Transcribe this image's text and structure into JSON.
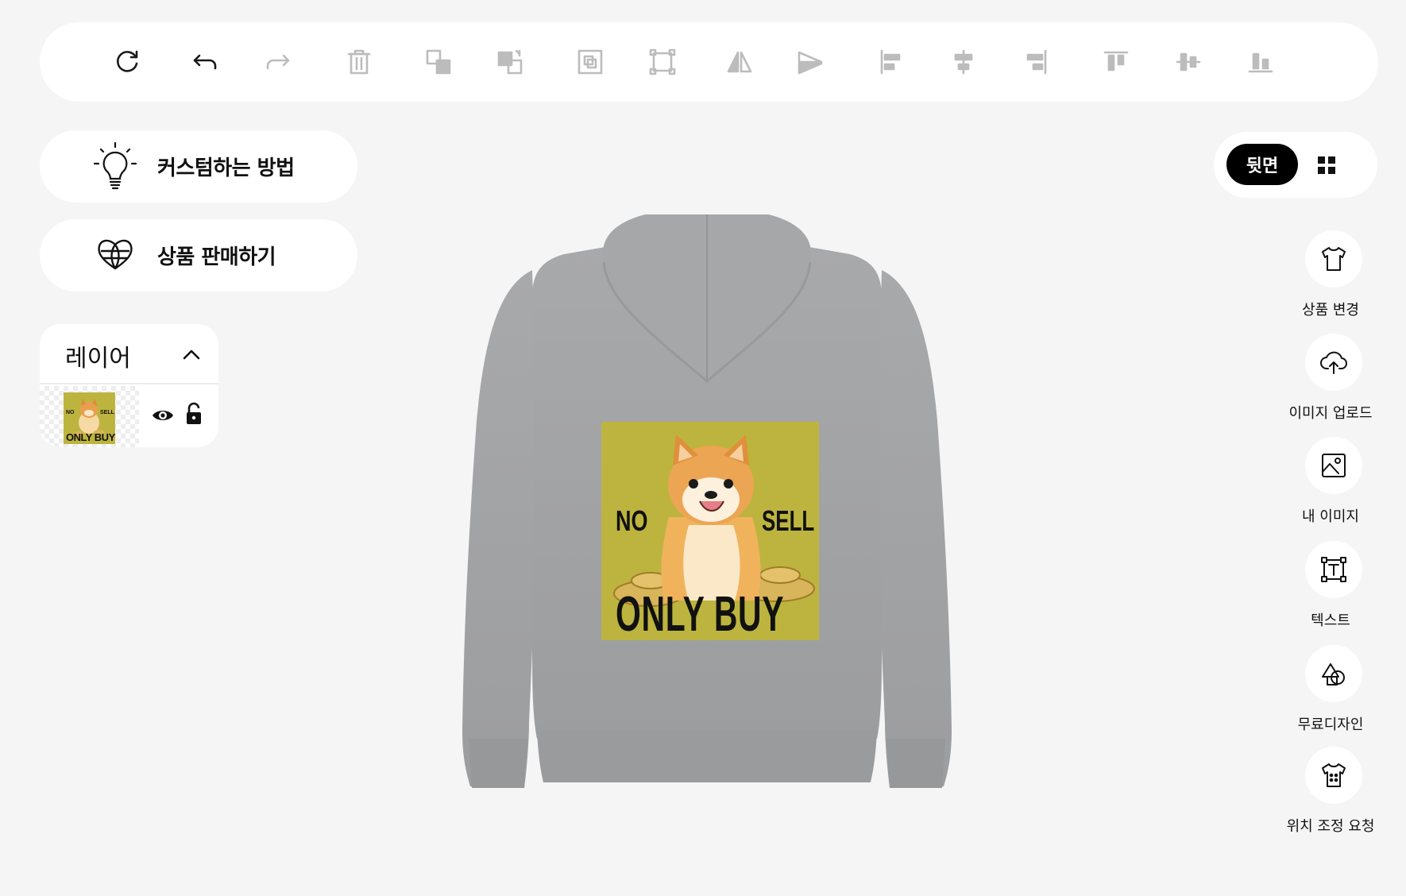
{
  "toolbar": {
    "buttons": [
      {
        "name": "refresh-icon"
      },
      {
        "name": "undo-icon"
      },
      {
        "name": "redo-icon"
      },
      {
        "name": "delete-icon"
      },
      {
        "name": "send-backward-icon"
      },
      {
        "name": "bring-forward-icon"
      },
      {
        "name": "group-icon"
      },
      {
        "name": "ungroup-icon"
      },
      {
        "name": "flip-horizontal-icon"
      },
      {
        "name": "flip-vertical-icon"
      },
      {
        "name": "align-left-icon"
      },
      {
        "name": "align-center-horizontal-icon"
      },
      {
        "name": "align-right-icon"
      },
      {
        "name": "align-top-icon"
      },
      {
        "name": "align-middle-vertical-icon"
      },
      {
        "name": "align-bottom-icon"
      }
    ]
  },
  "left": {
    "how_to_customize": "커스텀하는 방법",
    "sell_product": "상품 판매하기"
  },
  "layers": {
    "title": "레이어",
    "items": [
      {
        "thumb_top_left": "NO",
        "thumb_top_right": "SELL",
        "thumb_bottom": "ONLY BUY",
        "visible": true,
        "locked": false
      }
    ]
  },
  "view": {
    "side_label": "뒷면",
    "grid_icon": "grid-icon"
  },
  "right_tools": [
    {
      "label": "상품 변경",
      "icon": "tshirt-icon"
    },
    {
      "label": "이미지 업로드",
      "icon": "cloud-upload-icon"
    },
    {
      "label": "내 이미지",
      "icon": "image-icon"
    },
    {
      "label": "텍스트",
      "icon": "text-icon"
    },
    {
      "label": "무료디자인",
      "icon": "shapes-icon"
    },
    {
      "label": "위치 조정 요청",
      "icon": "position-tshirt-icon"
    }
  ],
  "canvas": {
    "product_color": "#a3a4a6",
    "design_bg": "#bdb43f",
    "design_text_left": "NO",
    "design_text_right": "SELL",
    "design_text_bottom": "ONLY BUY"
  }
}
